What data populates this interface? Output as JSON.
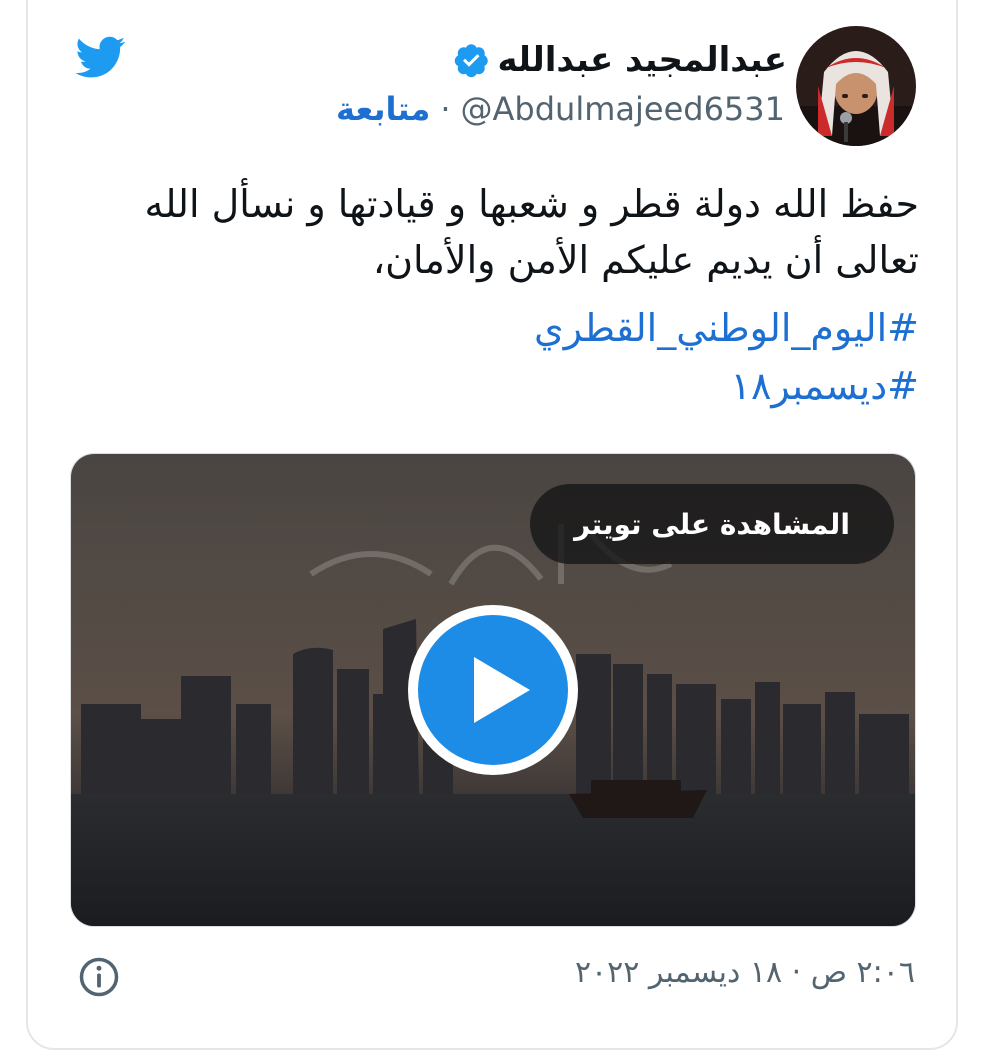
{
  "user": {
    "display_name": "عبدالمجيد عبدالله",
    "handle": "@Abdulmajeed6531",
    "separator": "·",
    "follow_label": "متابعة",
    "verified": true
  },
  "tweet": {
    "text": "حفظ الله دولة قطر و شعبها و قيادتها و نسأل الله تعالى أن يديم عليكم الأمن والأمان،",
    "hashtags": [
      "#اليوم_الوطني_القطري",
      "#ديسمبر١٨"
    ]
  },
  "media": {
    "watch_on_twitter_label": "المشاهدة على تويتر",
    "play_icon": "play-icon"
  },
  "timestamp": "٢:٠٦ ص · ١٨ ديسمبر ٢٠٢٢",
  "icons": {
    "logo": "twitter-bird-icon",
    "verified": "verified-badge-icon",
    "info": "info-icon"
  },
  "colors": {
    "accent": "#1d6fd1",
    "twitter_blue": "#1d9bf0",
    "play_blue": "#1d8ce6",
    "text": "#0f1419",
    "muted": "#536471"
  }
}
